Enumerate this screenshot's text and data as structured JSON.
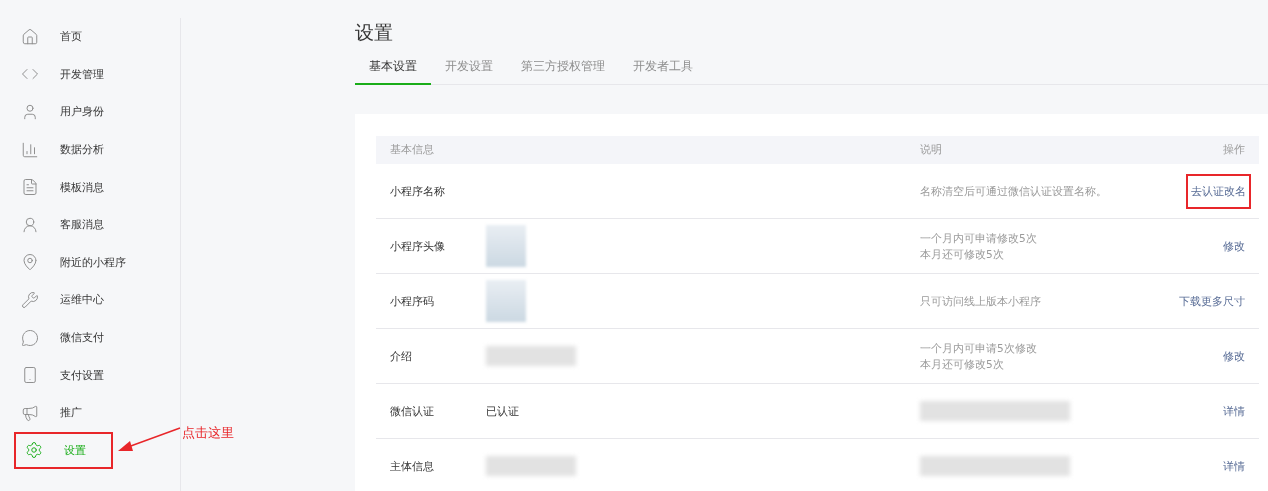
{
  "sidebar": {
    "items": [
      {
        "label": "首页",
        "selected": false,
        "highlighted": false
      },
      {
        "label": "开发管理",
        "selected": false,
        "highlighted": false
      },
      {
        "label": "用户身份",
        "selected": false,
        "highlighted": false
      },
      {
        "label": "数据分析",
        "selected": false,
        "highlighted": false
      },
      {
        "label": "模板消息",
        "selected": false,
        "highlighted": false
      },
      {
        "label": "客服消息",
        "selected": false,
        "highlighted": false
      },
      {
        "label": "附近的小程序",
        "selected": false,
        "highlighted": false
      },
      {
        "label": "运维中心",
        "selected": false,
        "highlighted": false
      },
      {
        "label": "微信支付",
        "selected": false,
        "highlighted": false
      },
      {
        "label": "支付设置",
        "selected": false,
        "highlighted": false
      },
      {
        "label": "推广",
        "selected": false,
        "highlighted": false
      },
      {
        "label": "设置",
        "selected": true,
        "highlighted": true
      }
    ]
  },
  "annotation": {
    "text": "点击这里"
  },
  "page": {
    "title": "设置"
  },
  "tabs": [
    {
      "label": "基本设置",
      "selected": true
    },
    {
      "label": "开发设置",
      "selected": false
    },
    {
      "label": "第三方授权管理",
      "selected": false
    },
    {
      "label": "开发者工具",
      "selected": false
    }
  ],
  "table": {
    "columns": [
      "基本信息",
      "说明",
      "操作"
    ],
    "rows": [
      {
        "label": "小程序名称",
        "description": {
          "kind": "text",
          "lines": [
            "名称清空后可通过微信认证设置名称。"
          ]
        },
        "action": "去认证改名",
        "highlighted": true
      },
      {
        "label": "小程序头像",
        "value": {
          "kind": "image"
        },
        "description": {
          "kind": "text",
          "lines": [
            "一个月内可申请修改5次",
            "本月还可修改5次"
          ]
        },
        "action": "修改",
        "highlighted": false
      },
      {
        "label": "小程序码",
        "value": {
          "kind": "image"
        },
        "description": {
          "kind": "text",
          "lines": [
            "只可访问线上版本小程序"
          ]
        },
        "action": "下载更多尺寸",
        "highlighted": false
      },
      {
        "label": "介绍",
        "value": {
          "kind": "obscured"
        },
        "description": {
          "kind": "text",
          "lines": [
            "一个月内可申请5次修改",
            "本月还可修改5次"
          ]
        },
        "action": "修改",
        "highlighted": false
      },
      {
        "label": "微信认证",
        "value": {
          "kind": "text",
          "text": "已认证"
        },
        "description": {
          "kind": "obscured"
        },
        "action": "详情",
        "highlighted": false
      },
      {
        "label": "主体信息",
        "value": {
          "kind": "obscured"
        },
        "description": {
          "kind": "obscured"
        },
        "action": "详情",
        "highlighted": false
      }
    ]
  }
}
